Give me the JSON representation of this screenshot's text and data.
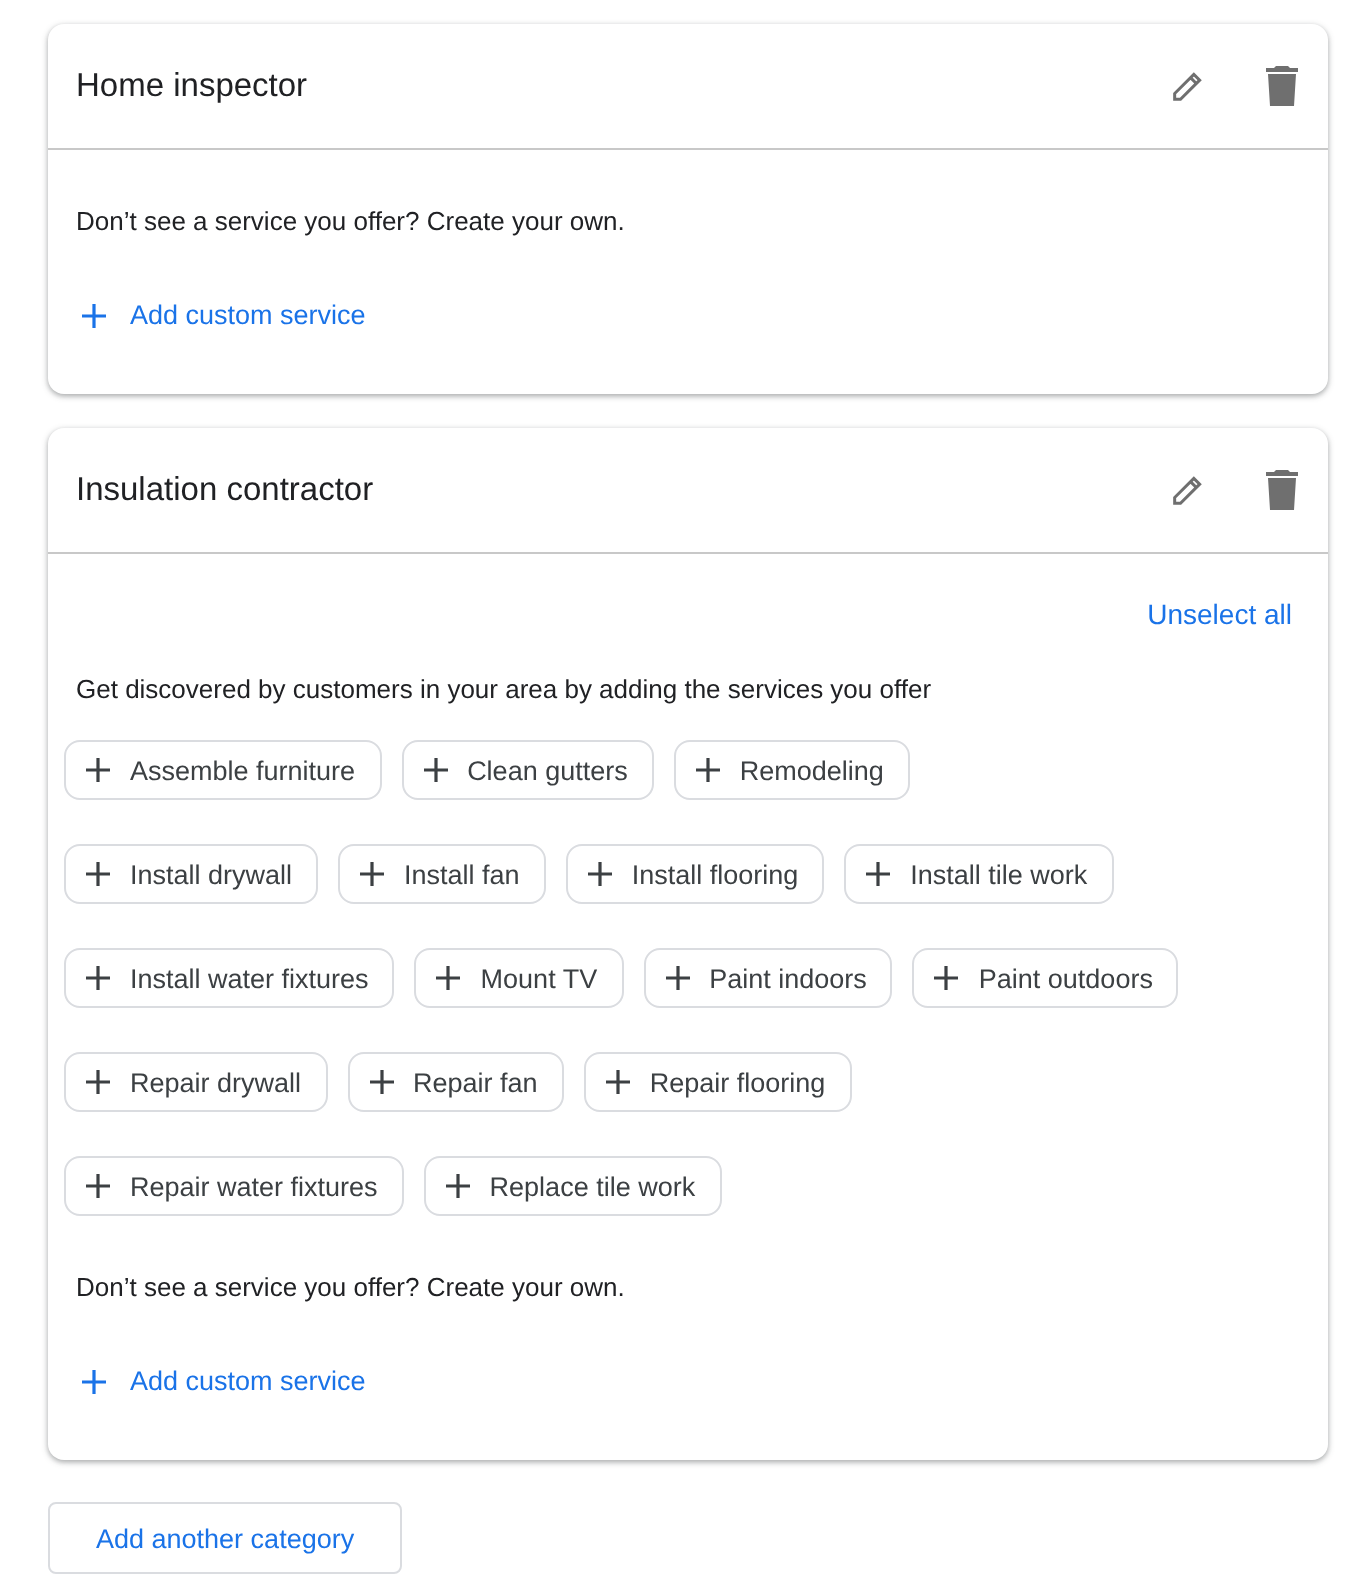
{
  "categories": [
    {
      "title": "Home inspector",
      "custom_prompt": "Don’t see a service you offer? Create your own.",
      "add_custom": "Add custom service"
    },
    {
      "title": "Insulation contractor",
      "unselect_all": "Unselect all",
      "intro": "Get discovered by customers in your area by adding the services you offer",
      "chip_rows": [
        [
          "Assemble furniture",
          "Clean gutters",
          "Remodeling"
        ],
        [
          "Install drywall",
          "Install fan",
          "Install flooring",
          "Install tile work"
        ],
        [
          "Install water fixtures",
          "Mount TV",
          "Paint indoors",
          "Paint outdoors"
        ],
        [
          "Repair drywall",
          "Repair fan",
          "Repair flooring"
        ],
        [
          "Repair water fixtures",
          "Replace tile work"
        ]
      ],
      "custom_prompt": "Don’t see a service you offer? Create your own.",
      "add_custom": "Add custom service"
    }
  ],
  "add_category": "Add another category"
}
